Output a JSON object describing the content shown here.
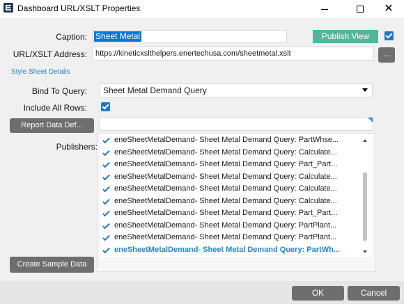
{
  "window": {
    "title": "Dashboard URL/XSLT Properties",
    "icon": "app-logo-icon",
    "controls": [
      "minimize-icon",
      "maximize-icon",
      "close-icon"
    ]
  },
  "form": {
    "caption_label": "Caption:",
    "caption_value": "Sheet Metal",
    "publish_button": "Publish View",
    "publish_checked": true,
    "url_label": "URL/XSLT Address:",
    "url_value": "https://kineticxslthelpers.enertechusa.com/sheetmetal.xslt",
    "browse_button": "...",
    "style_sheet_link": "Style Sheet Details",
    "bind_label": "Bind To Query:",
    "bind_value": "Sheet Metal Demand Query",
    "include_label": "Include All Rows:",
    "include_checked": true,
    "report_button": "Report Data Def...",
    "report_value": "",
    "publishers_label": "Publishers:",
    "sample_button": "Create Sample Data"
  },
  "publishers": [
    {
      "text": "eneSheetMetalDemand- Sheet Metal Demand Query: PartWhse...",
      "checked": true
    },
    {
      "text": "eneSheetMetalDemand- Sheet Metal Demand Query: Calculate...",
      "checked": true
    },
    {
      "text": "eneSheetMetalDemand- Sheet Metal Demand Query: Part_Part...",
      "checked": true
    },
    {
      "text": "eneSheetMetalDemand- Sheet Metal Demand Query: Calculate...",
      "checked": true
    },
    {
      "text": "eneSheetMetalDemand- Sheet Metal Demand Query: Calculate...",
      "checked": true
    },
    {
      "text": "eneSheetMetalDemand- Sheet Metal Demand Query: Calculate...",
      "checked": true
    },
    {
      "text": "eneSheetMetalDemand- Sheet Metal Demand Query: Part_Part...",
      "checked": true
    },
    {
      "text": "eneSheetMetalDemand- Sheet Metal Demand Query: PartPlant...",
      "checked": true
    },
    {
      "text": "eneSheetMetalDemand- Sheet Metal Demand Query: PartPlant...",
      "checked": true
    },
    {
      "text": "eneSheetMetalDemand- Sheet Metal Demand Query: PartWh...",
      "checked": true,
      "active": true
    }
  ],
  "footer": {
    "ok_button": "OK",
    "cancel_button": "Cancel"
  },
  "colors": {
    "accent": "#1f78c8",
    "publish": "#53b59b",
    "button": "#6e6e6e"
  }
}
